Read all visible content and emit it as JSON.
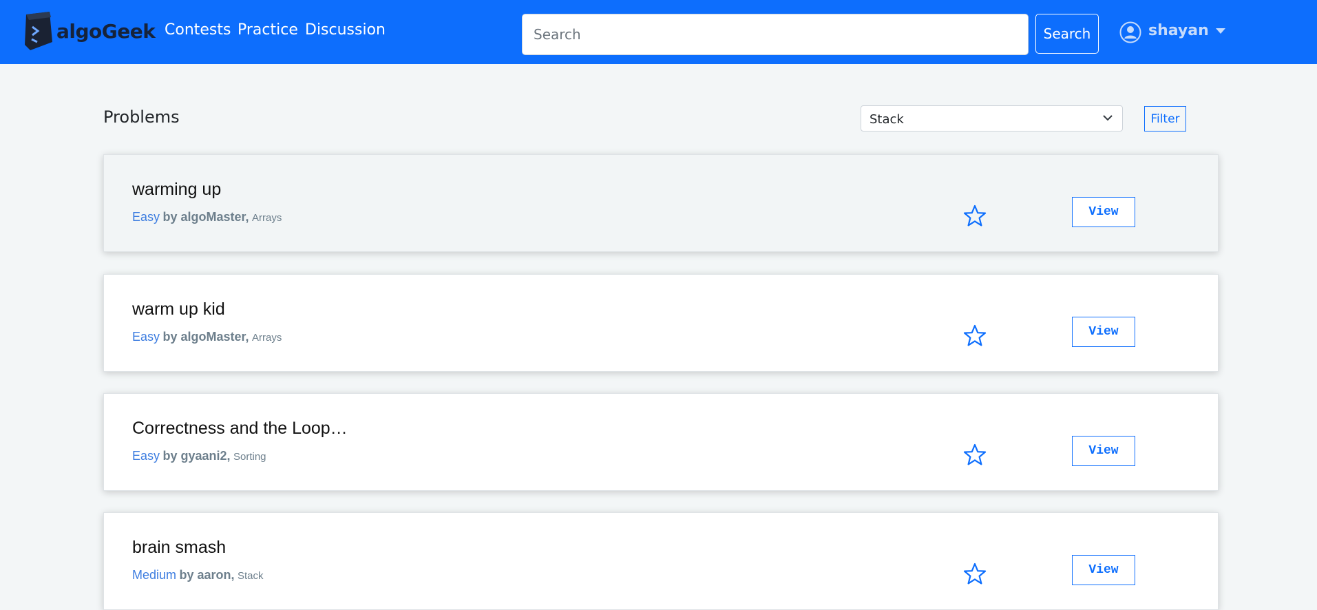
{
  "navbar": {
    "brand": "algoGeek",
    "links": [
      {
        "label": "Contests"
      },
      {
        "label": "Practice"
      },
      {
        "label": "Discussion"
      }
    ],
    "search": {
      "placeholder": "Search",
      "value": ""
    },
    "search_button": "Search",
    "user": {
      "name": "shayan"
    }
  },
  "main": {
    "title": "Problems",
    "filter": {
      "selected": "Stack",
      "button_label": "Filter"
    }
  },
  "problems": [
    {
      "title": "warming up",
      "difficulty": "Easy",
      "by": "by algoMaster,",
      "tag": "Arrays",
      "action": "View"
    },
    {
      "title": "warm up kid",
      "difficulty": "Easy",
      "by": "by algoMaster,",
      "tag": "Arrays",
      "action": "View"
    },
    {
      "title": "Correctness and the Loop…",
      "difficulty": "Easy",
      "by": "by gyaani2,",
      "tag": "Sorting",
      "action": "View"
    },
    {
      "title": "brain smash",
      "difficulty": "Medium",
      "by": "by aaron,",
      "tag": "Stack",
      "action": "View"
    }
  ],
  "colors": {
    "navbar": "#0d6efd",
    "background": "#f3f6f7",
    "accent": "#0d6efd",
    "difficulty": "#3d7de0",
    "meta": "#6d7f8c"
  }
}
